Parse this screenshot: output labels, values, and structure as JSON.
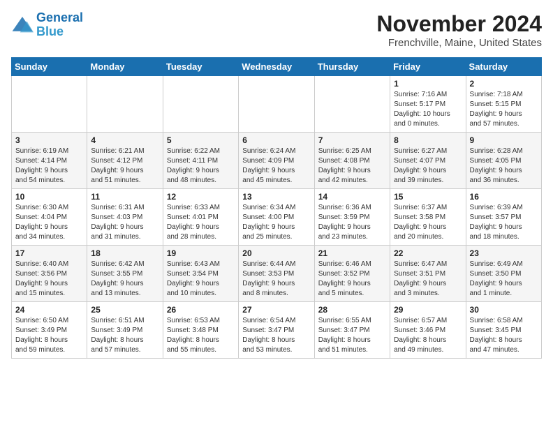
{
  "header": {
    "logo_line1": "General",
    "logo_line2": "Blue",
    "month_title": "November 2024",
    "location": "Frenchville, Maine, United States"
  },
  "days_of_week": [
    "Sunday",
    "Monday",
    "Tuesday",
    "Wednesday",
    "Thursday",
    "Friday",
    "Saturday"
  ],
  "weeks": [
    [
      {
        "day": "",
        "info": ""
      },
      {
        "day": "",
        "info": ""
      },
      {
        "day": "",
        "info": ""
      },
      {
        "day": "",
        "info": ""
      },
      {
        "day": "",
        "info": ""
      },
      {
        "day": "1",
        "info": "Sunrise: 7:16 AM\nSunset: 5:17 PM\nDaylight: 10 hours\nand 0 minutes."
      },
      {
        "day": "2",
        "info": "Sunrise: 7:18 AM\nSunset: 5:15 PM\nDaylight: 9 hours\nand 57 minutes."
      }
    ],
    [
      {
        "day": "3",
        "info": "Sunrise: 6:19 AM\nSunset: 4:14 PM\nDaylight: 9 hours\nand 54 minutes."
      },
      {
        "day": "4",
        "info": "Sunrise: 6:21 AM\nSunset: 4:12 PM\nDaylight: 9 hours\nand 51 minutes."
      },
      {
        "day": "5",
        "info": "Sunrise: 6:22 AM\nSunset: 4:11 PM\nDaylight: 9 hours\nand 48 minutes."
      },
      {
        "day": "6",
        "info": "Sunrise: 6:24 AM\nSunset: 4:09 PM\nDaylight: 9 hours\nand 45 minutes."
      },
      {
        "day": "7",
        "info": "Sunrise: 6:25 AM\nSunset: 4:08 PM\nDaylight: 9 hours\nand 42 minutes."
      },
      {
        "day": "8",
        "info": "Sunrise: 6:27 AM\nSunset: 4:07 PM\nDaylight: 9 hours\nand 39 minutes."
      },
      {
        "day": "9",
        "info": "Sunrise: 6:28 AM\nSunset: 4:05 PM\nDaylight: 9 hours\nand 36 minutes."
      }
    ],
    [
      {
        "day": "10",
        "info": "Sunrise: 6:30 AM\nSunset: 4:04 PM\nDaylight: 9 hours\nand 34 minutes."
      },
      {
        "day": "11",
        "info": "Sunrise: 6:31 AM\nSunset: 4:03 PM\nDaylight: 9 hours\nand 31 minutes."
      },
      {
        "day": "12",
        "info": "Sunrise: 6:33 AM\nSunset: 4:01 PM\nDaylight: 9 hours\nand 28 minutes."
      },
      {
        "day": "13",
        "info": "Sunrise: 6:34 AM\nSunset: 4:00 PM\nDaylight: 9 hours\nand 25 minutes."
      },
      {
        "day": "14",
        "info": "Sunrise: 6:36 AM\nSunset: 3:59 PM\nDaylight: 9 hours\nand 23 minutes."
      },
      {
        "day": "15",
        "info": "Sunrise: 6:37 AM\nSunset: 3:58 PM\nDaylight: 9 hours\nand 20 minutes."
      },
      {
        "day": "16",
        "info": "Sunrise: 6:39 AM\nSunset: 3:57 PM\nDaylight: 9 hours\nand 18 minutes."
      }
    ],
    [
      {
        "day": "17",
        "info": "Sunrise: 6:40 AM\nSunset: 3:56 PM\nDaylight: 9 hours\nand 15 minutes."
      },
      {
        "day": "18",
        "info": "Sunrise: 6:42 AM\nSunset: 3:55 PM\nDaylight: 9 hours\nand 13 minutes."
      },
      {
        "day": "19",
        "info": "Sunrise: 6:43 AM\nSunset: 3:54 PM\nDaylight: 9 hours\nand 10 minutes."
      },
      {
        "day": "20",
        "info": "Sunrise: 6:44 AM\nSunset: 3:53 PM\nDaylight: 9 hours\nand 8 minutes."
      },
      {
        "day": "21",
        "info": "Sunrise: 6:46 AM\nSunset: 3:52 PM\nDaylight: 9 hours\nand 5 minutes."
      },
      {
        "day": "22",
        "info": "Sunrise: 6:47 AM\nSunset: 3:51 PM\nDaylight: 9 hours\nand 3 minutes."
      },
      {
        "day": "23",
        "info": "Sunrise: 6:49 AM\nSunset: 3:50 PM\nDaylight: 9 hours\nand 1 minute."
      }
    ],
    [
      {
        "day": "24",
        "info": "Sunrise: 6:50 AM\nSunset: 3:49 PM\nDaylight: 8 hours\nand 59 minutes."
      },
      {
        "day": "25",
        "info": "Sunrise: 6:51 AM\nSunset: 3:49 PM\nDaylight: 8 hours\nand 57 minutes."
      },
      {
        "day": "26",
        "info": "Sunrise: 6:53 AM\nSunset: 3:48 PM\nDaylight: 8 hours\nand 55 minutes."
      },
      {
        "day": "27",
        "info": "Sunrise: 6:54 AM\nSunset: 3:47 PM\nDaylight: 8 hours\nand 53 minutes."
      },
      {
        "day": "28",
        "info": "Sunrise: 6:55 AM\nSunset: 3:47 PM\nDaylight: 8 hours\nand 51 minutes."
      },
      {
        "day": "29",
        "info": "Sunrise: 6:57 AM\nSunset: 3:46 PM\nDaylight: 8 hours\nand 49 minutes."
      },
      {
        "day": "30",
        "info": "Sunrise: 6:58 AM\nSunset: 3:45 PM\nDaylight: 8 hours\nand 47 minutes."
      }
    ]
  ]
}
